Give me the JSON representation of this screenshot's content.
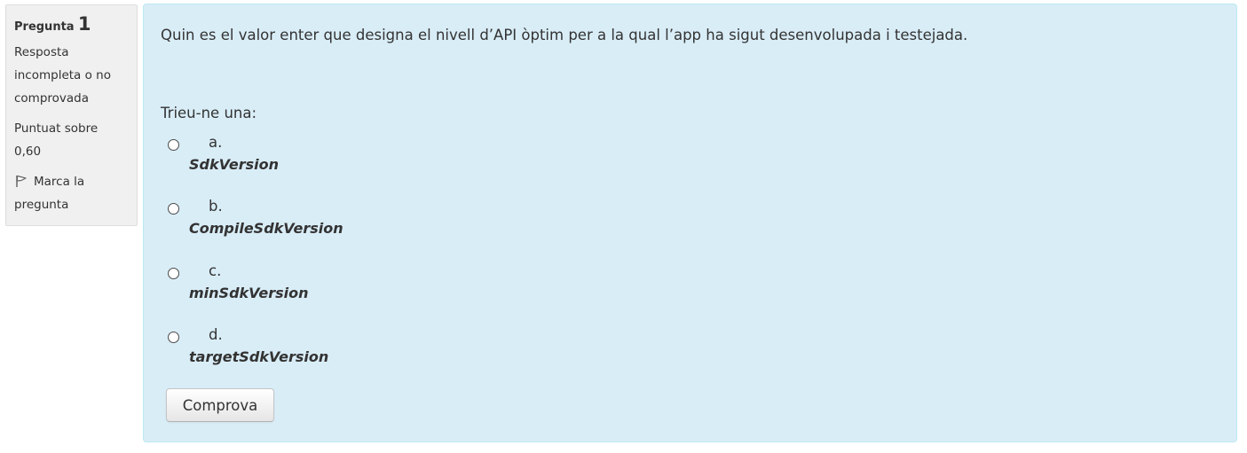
{
  "info": {
    "question_label": "Pregunta",
    "question_number": "1",
    "state_lines": [
      "Resposta",
      "incompleta o no",
      "comprovada"
    ],
    "grade_lines": [
      "Puntuat sobre",
      "0,60"
    ],
    "flag_lines": [
      "Marca la",
      "pregunta"
    ],
    "flag_icon": "flag-icon"
  },
  "question": {
    "text": "Quin es el valor enter que designa el nivell d’API òptim per a la qual l’app ha sigut desenvolupada i testejada.",
    "prompt": "Trieu-ne una:",
    "answers": [
      {
        "letter": "a.",
        "label": "SdkVersion",
        "selected": false
      },
      {
        "letter": "b.",
        "label": "CompileSdkVersion",
        "selected": false
      },
      {
        "letter": "c.",
        "label": "minSdkVersion",
        "selected": false
      },
      {
        "letter": "d.",
        "label": "targetSdkVersion",
        "selected": false
      }
    ],
    "check_button": "Comprova"
  },
  "colors": {
    "content_bg": "#d9edf7",
    "content_border": "#bce8f1",
    "info_bg": "#f0f0f0",
    "text": "#333333"
  }
}
